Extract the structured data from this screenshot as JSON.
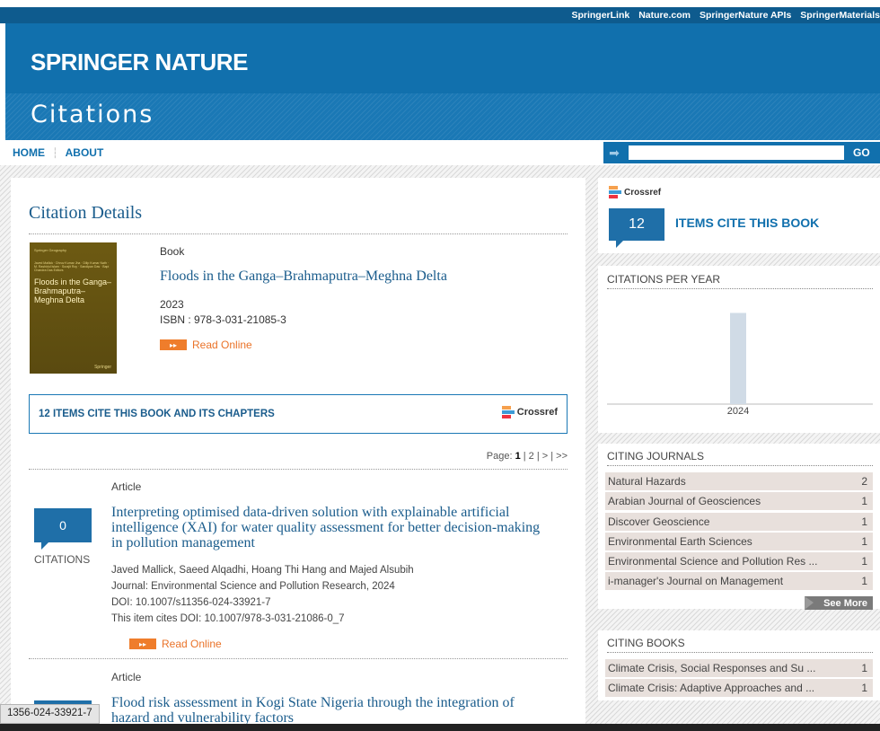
{
  "top_links": [
    "SpringerLink",
    "Nature.com",
    "SpringerNature APIs",
    "SpringerMaterials"
  ],
  "brand": "SPRINGER NATURE",
  "section_title": "Citations",
  "nav": {
    "home": "HOME",
    "about": "ABOUT"
  },
  "search": {
    "value": "",
    "go": "GO"
  },
  "citation_details": {
    "heading": "Citation Details",
    "book": {
      "type": "Book",
      "title": "Floods in the Ganga–Brahmaputra–Meghna Delta",
      "year": "2023",
      "isbn": "ISBN : 978-3-031-21085-3",
      "read_online": "Read Online",
      "cover": {
        "publisher": "Springer Geography",
        "authors": "Javed Mallick · Dhruv Kumar Jha · Dilip Kumar Nath · M. Rashidul Islam · Surajit Roy · Sandipan Das · Bapi Chandra Das  Editors",
        "title": "Floods in the Ganga– Brahmaputra– Meghna Delta",
        "imprint": "Springer"
      }
    },
    "cite_box": {
      "text": "12 ITEMS CITE THIS BOOK AND ITS CHAPTERS",
      "crossref": "Crossref"
    },
    "pager": {
      "label": "Page:",
      "current": "1",
      "rest": "| 2 | > | >>"
    }
  },
  "items": [
    {
      "type": "Article",
      "count": "0",
      "count_label": "CITATIONS",
      "title": "Interpreting optimised data-driven solution with explainable artificial intelligence (XAI) for water quality assessment for better decision-making in pollution management",
      "authors": "Javed Mallick, Saeed Alqadhi, Hoang Thi Hang and Majed Alsubih",
      "journal": "Journal: Environmental Science and Pollution Research, 2024",
      "doi": "DOI: 10.1007/s11356-024-33921-7",
      "cites": "This item cites DOI: 10.1007/978-3-031-21086-0_7",
      "read_online": "Read Online"
    },
    {
      "type": "Article",
      "title": "Flood risk assessment in Kogi State Nigeria through the integration of hazard and vulnerability factors"
    }
  ],
  "sidebar": {
    "crossref": "Crossref",
    "count": "12",
    "count_text": "ITEMS CITE THIS BOOK",
    "per_year_title": "CITATIONS PER YEAR",
    "journals_title": "CITING JOURNALS",
    "journals": [
      {
        "name": "Natural Hazards",
        "count": "2"
      },
      {
        "name": "Arabian Journal of Geosciences",
        "count": "1"
      },
      {
        "name": "Discover Geoscience",
        "count": "1"
      },
      {
        "name": "Environmental Earth Sciences",
        "count": "1"
      },
      {
        "name": "Environmental Science and Pollution Res ...",
        "count": "1"
      },
      {
        "name": "i-manager's Journal on Management",
        "count": "1"
      }
    ],
    "see_more": "See More",
    "books_title": "CITING BOOKS",
    "books": [
      {
        "name": "Climate Crisis, Social Responses and Su ...",
        "count": "1"
      },
      {
        "name": "Climate Crisis: Adaptive Approaches and ...",
        "count": "1"
      }
    ]
  },
  "status_url": "1356-024-33921-7",
  "colors": {
    "brand_blue": "#1170ad",
    "badge_blue": "#1f6fa8",
    "orange": "#ea7329"
  },
  "chart_data": {
    "type": "bar",
    "categories": [
      "2024"
    ],
    "values": [
      12
    ],
    "title": "",
    "xlabel": "",
    "ylabel": "",
    "ylim": [
      0,
      13
    ]
  }
}
